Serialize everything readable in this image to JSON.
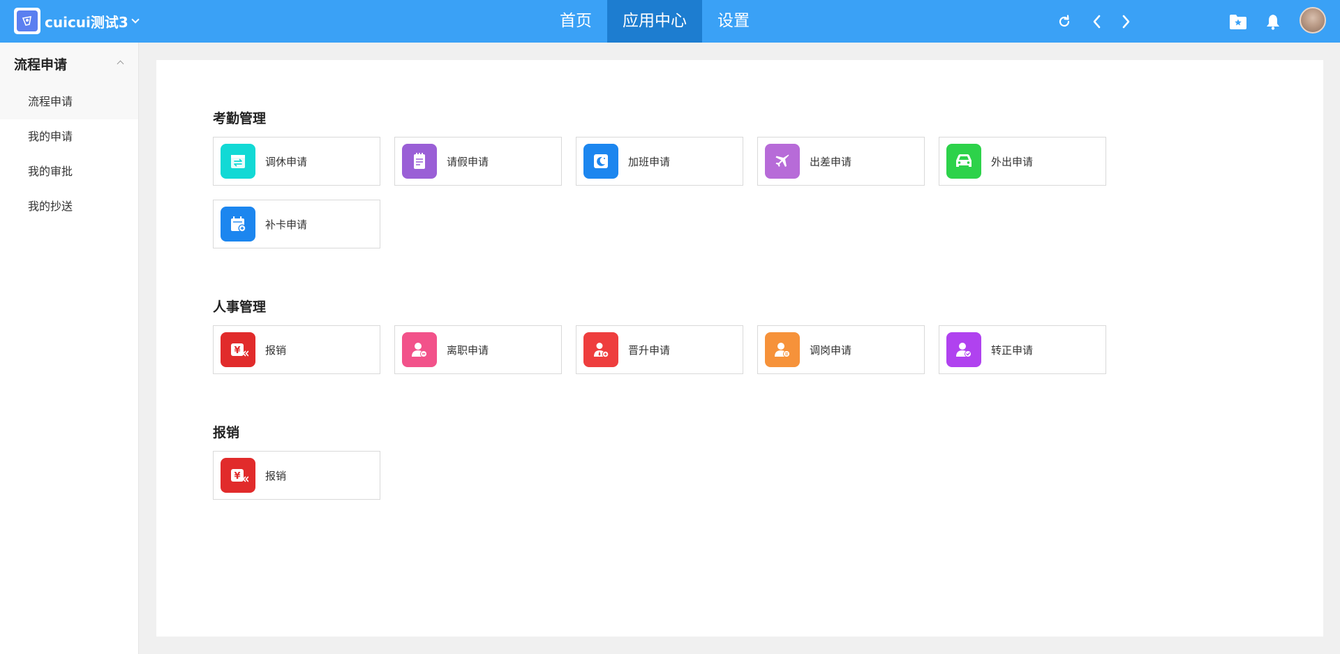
{
  "header": {
    "brand": "cuicui测试3",
    "nav": [
      "首页",
      "应用中心",
      "设置"
    ],
    "active_nav": "应用中心",
    "colors": {
      "bar": "#3aa1f6",
      "active": "#1d7dd0"
    }
  },
  "sidebar": {
    "group_title": "流程申请",
    "items": [
      "流程申请",
      "我的申请",
      "我的审批",
      "我的抄送"
    ]
  },
  "sections": [
    {
      "title": "考勤管理",
      "apps": [
        {
          "label": "调休申请",
          "icon": "swap-icon",
          "color": "#12d9d5"
        },
        {
          "label": "请假申请",
          "icon": "document-icon",
          "color": "#9a5fd6"
        },
        {
          "label": "加班申请",
          "icon": "moon-icon",
          "color": "#1c86ef"
        },
        {
          "label": "出差申请",
          "icon": "airplane-icon",
          "color": "#b76bd8"
        },
        {
          "label": "外出申请",
          "icon": "car-icon",
          "color": "#2dd24a"
        },
        {
          "label": "补卡申请",
          "icon": "calendar-add-icon",
          "color": "#1c86ef"
        }
      ]
    },
    {
      "title": "人事管理",
      "apps": [
        {
          "label": "报销",
          "icon": "yen-icon",
          "color": "#e12b2b"
        },
        {
          "label": "离职申请",
          "icon": "user-minus-icon",
          "color": "#f2528a"
        },
        {
          "label": "晋升申请",
          "icon": "user-up-icon",
          "color": "#ee3e3e"
        },
        {
          "label": "调岗申请",
          "icon": "user-swap-icon",
          "color": "#f6923a"
        },
        {
          "label": "转正申请",
          "icon": "user-check-icon",
          "color": "#b042ef"
        }
      ]
    },
    {
      "title": "报销",
      "apps": [
        {
          "label": "报销",
          "icon": "yen-icon",
          "color": "#e12b2b"
        }
      ]
    }
  ]
}
